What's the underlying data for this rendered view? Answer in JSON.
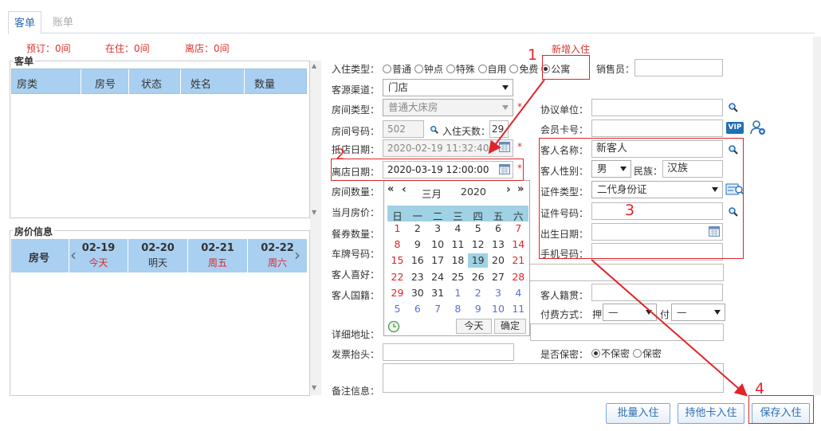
{
  "tabs": {
    "guest": "客单",
    "bill": "账单"
  },
  "stats": {
    "booked": "预订：0间",
    "in_house": "在住：0间",
    "checked_out": "离店：0间"
  },
  "new_checkin": "新增入住",
  "guest_panel": {
    "legend": "客单",
    "columns": [
      "房类",
      "房号",
      "状态",
      "姓名",
      "数量"
    ]
  },
  "price_panel": {
    "legend": "房价信息",
    "room_label": "房号",
    "days": [
      {
        "date": "02-19",
        "day": "今天"
      },
      {
        "date": "02-20",
        "day": "明天"
      },
      {
        "date": "02-21",
        "day": "周五"
      },
      {
        "date": "02-22",
        "day": "周六"
      }
    ]
  },
  "form": {
    "checkin_type_label": "入住类型：",
    "checkin_types": [
      "普通",
      "钟点",
      "特殊",
      "自用",
      "免费",
      "公寓"
    ],
    "salesperson_label": "销售员：",
    "channel_label": "客源渠道：",
    "channel_value": "门店",
    "room_type_label": "房间类型：",
    "room_type_value": "普通大床房",
    "room_no_label": "房间号码：",
    "room_no_value": "502",
    "stay_days_label": "入住天数：",
    "stay_days_value": "29",
    "arrival_label": "抵店日期：",
    "arrival_value": "2020-02-19 11:32:40",
    "departure_label": "离店日期：",
    "departure_value": "2020-03-19 12:00:00",
    "room_count_label": "房间数量：",
    "month_price_label": "当月房价：",
    "coupon_label": "餐券数量：",
    "plate_label": "车牌号码：",
    "hobby_label": "客人喜好：",
    "nationality_label": "客人国籍：",
    "address_label": "详细地址：",
    "invoice_label": "发票抬头：",
    "remark_label": "备注信息：",
    "agreement_label": "协议单位：",
    "member_label": "会员卡号：",
    "vip_text": "VIP",
    "guest_name_label": "客人名称：",
    "guest_name_value": "新客人",
    "gender_label": "客人性别：",
    "gender_value": "男",
    "ethnic_label": "民族：",
    "ethnic_value": "汉族",
    "id_type_label": "证件类型：",
    "id_type_value": "二代身份证",
    "id_no_label": "证件号码：",
    "birth_label": "出生日期：",
    "phone_label": "手机号码：",
    "origin_label": "客人籍贯：",
    "payment_label": "付费方式：",
    "deposit_prefix": "押",
    "pay_prefix": "付",
    "deposit_value": "—",
    "pay_value": "—",
    "confidential_label": "是否保密：",
    "confidential_options": [
      "不保密",
      "保密"
    ]
  },
  "calendar": {
    "month": "三月",
    "year": "2020",
    "weekdays": [
      "日",
      "一",
      "二",
      "三",
      "四",
      "五",
      "六"
    ],
    "days": [
      [
        "1",
        "2",
        "3",
        "4",
        "5",
        "6",
        "7"
      ],
      [
        "8",
        "9",
        "10",
        "11",
        "12",
        "13",
        "14"
      ],
      [
        "15",
        "16",
        "17",
        "18",
        "19",
        "20",
        "21"
      ],
      [
        "22",
        "23",
        "24",
        "25",
        "26",
        "27",
        "28"
      ],
      [
        "29",
        "30",
        "31",
        "1",
        "2",
        "3",
        "4"
      ],
      [
        "5",
        "6",
        "7",
        "8",
        "9",
        "10",
        "11"
      ]
    ],
    "today_btn": "今天",
    "ok_btn": "确定",
    "nav": {
      "prev_year": "«",
      "prev_month": "‹",
      "next_month": "›",
      "next_year": "»"
    }
  },
  "buttons": {
    "batch": "批量入住",
    "other_card": "持他卡入住",
    "save": "保存入住"
  },
  "annotations": [
    "1",
    "2",
    "3",
    "4"
  ],
  "colors": {
    "accent": "#2a6db5",
    "red": "#e0242a",
    "header_blue": "#a9d0f0",
    "today": "#9fd2e4"
  }
}
